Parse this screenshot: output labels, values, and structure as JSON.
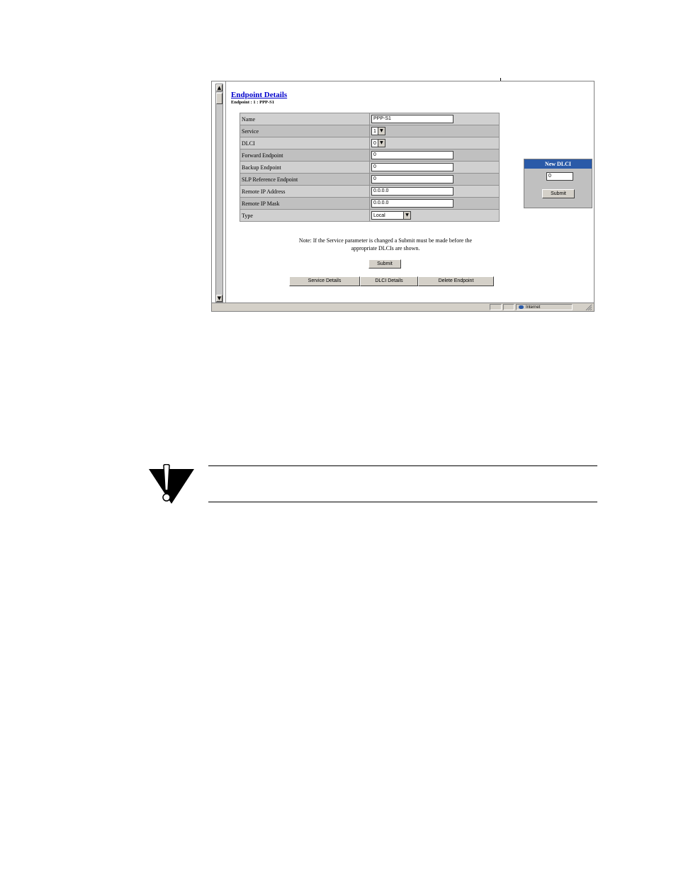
{
  "page": {
    "title": "Endpoint Details",
    "subtitle": "Endpoint : 1 : PPP-S1"
  },
  "form": {
    "rows": [
      {
        "label": "Name",
        "value": "PPP-S1",
        "kind": "input"
      },
      {
        "label": "Service",
        "value": "1",
        "kind": "select"
      },
      {
        "label": "DLCI",
        "value": "0",
        "kind": "select"
      },
      {
        "label": "Forward Endpoint",
        "value": "0",
        "kind": "input"
      },
      {
        "label": "Backup Endpoint",
        "value": "0",
        "kind": "input"
      },
      {
        "label": "SLP Reference Endpoint",
        "value": "0",
        "kind": "input"
      },
      {
        "label": "Remote IP Address",
        "value": "0.0.0.0",
        "kind": "input"
      },
      {
        "label": "Remote IP Mask",
        "value": "0.0.0.0",
        "kind": "input"
      },
      {
        "label": "Type",
        "value": "Local",
        "kind": "select"
      }
    ]
  },
  "new_dlci": {
    "title": "New DLCI",
    "value": "0",
    "submit_label": "Submit"
  },
  "note": {
    "line1": "Note:  If the Service parameter is changed a Submit must be made before the",
    "line2": "appropriate DLCIs are shown."
  },
  "actions": {
    "submit_label": "Submit",
    "service_details_label": "Service Details",
    "dlci_details_label": "DLCI Details",
    "delete_endpoint_label": "Delete Endpoint"
  },
  "statusbar": {
    "zone_label": "Internet"
  },
  "colors": {
    "link": "#0000cc",
    "panel_header": "#2a5aa8",
    "table_bg": "#c0c0c0"
  },
  "icons": {
    "caution": "caution-icon",
    "scroll_up": "scroll-up-icon",
    "scroll_down": "scroll-down-icon",
    "dropdown": "chevron-down-icon",
    "zone": "internet-zone-icon"
  }
}
